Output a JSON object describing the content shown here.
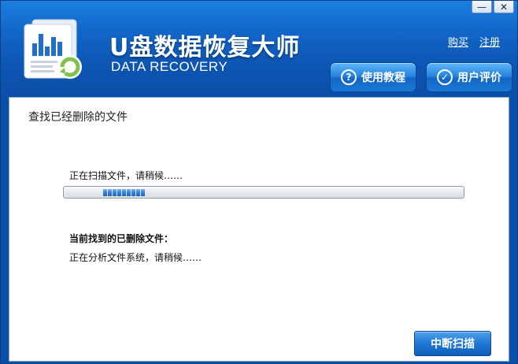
{
  "window": {
    "minimize_glyph": "—",
    "close_glyph": "✕"
  },
  "header": {
    "title": "U盘数据恢复大师",
    "subtitle": "DATA RECOVERY",
    "links": {
      "buy": "购买",
      "register": "注册"
    },
    "buttons": {
      "tutorial": {
        "label": "使用教程",
        "icon": "question-circle-icon",
        "glyph": "?"
      },
      "review": {
        "label": "用户评价",
        "icon": "speech-bubble-icon",
        "glyph": "✓"
      }
    }
  },
  "content": {
    "section_title": "查找已经删除的文件",
    "scan_status": "正在扫描文件，请稍候……",
    "found_label": "当前找到的已删除文件：",
    "found_status": "正在分析文件系统，请稍候……",
    "stop_button": "中断扫描"
  },
  "colors": {
    "header_blue": "#1266c8",
    "progress_fill": "#2f7fd8",
    "logo_accent": "#7fc24a"
  }
}
